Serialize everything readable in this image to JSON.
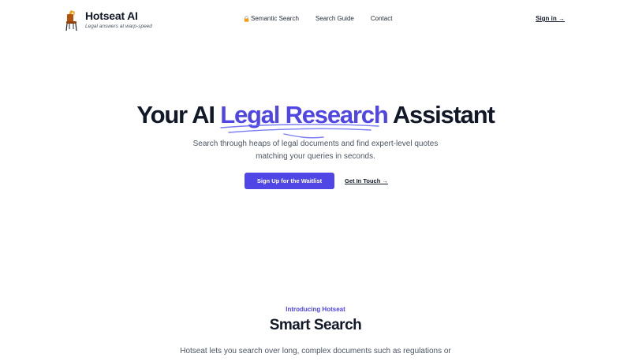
{
  "header": {
    "brand_name": "Hotseat AI",
    "tagline": "Legal answers at warp-speed",
    "logo_icon": "chair-icon",
    "nav": [
      {
        "label": "Semantic Search",
        "icon": "lock-icon"
      },
      {
        "label": "Search Guide"
      },
      {
        "label": "Contact"
      }
    ],
    "signin_label": "Sign in →"
  },
  "hero": {
    "title_before": "Your AI ",
    "title_accent": "Legal Research",
    "title_after": " Assistant",
    "subtitle_line1": "Search through heaps of legal documents and find expert-level quotes",
    "subtitle_line2": "matching your queries in seconds.",
    "primary_cta": "Sign Up for the Waitlist",
    "secondary_cta": "Get In Touch →"
  },
  "intro": {
    "eyebrow": "Introducing Hotseat",
    "title": "Smart Search",
    "text": "Hotseat lets you search over long, complex documents such as regulations or"
  },
  "colors": {
    "accent": "#4f46e5",
    "text": "#111827",
    "muted": "#4b5563"
  }
}
